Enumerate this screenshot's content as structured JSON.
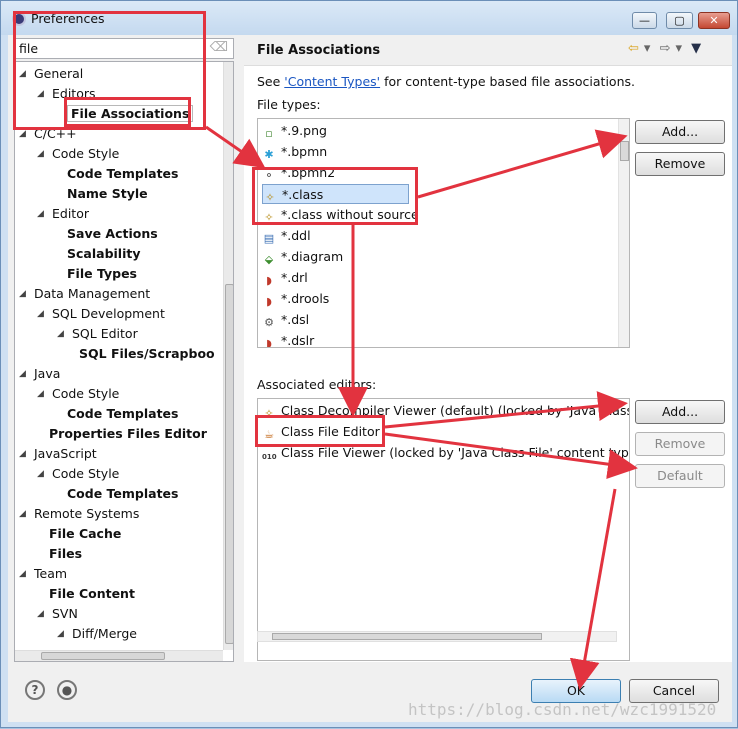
{
  "window": {
    "title": "Preferences",
    "min": "—",
    "max": "▢",
    "close": "✕"
  },
  "filter": {
    "value": "file"
  },
  "tree": [
    {
      "label": "General",
      "arrow": "◢",
      "bold": false
    },
    {
      "label": "Editors",
      "arrow": "◢",
      "bold": false
    },
    {
      "label": "File Associations",
      "arrow": "",
      "bold": true
    },
    {
      "label": "C/C++",
      "arrow": "◢",
      "bold": false
    },
    {
      "label": "Code Style",
      "arrow": "◢",
      "bold": false
    },
    {
      "label": "Code Templates",
      "arrow": "",
      "bold": true
    },
    {
      "label": "Name Style",
      "arrow": "",
      "bold": true
    },
    {
      "label": "Editor",
      "arrow": "◢",
      "bold": false
    },
    {
      "label": "Save Actions",
      "arrow": "",
      "bold": true
    },
    {
      "label": "Scalability",
      "arrow": "",
      "bold": true
    },
    {
      "label": "File Types",
      "arrow": "",
      "bold": true
    },
    {
      "label": "Data Management",
      "arrow": "◢",
      "bold": false
    },
    {
      "label": "SQL Development",
      "arrow": "◢",
      "bold": false
    },
    {
      "label": "SQL Editor",
      "arrow": "◢",
      "bold": false
    },
    {
      "label": "SQL Files/Scrapboo",
      "arrow": "",
      "bold": true
    },
    {
      "label": "Java",
      "arrow": "◢",
      "bold": false
    },
    {
      "label": "Code Style",
      "arrow": "◢",
      "bold": false
    },
    {
      "label": "Code Templates",
      "arrow": "",
      "bold": true
    },
    {
      "label": "Properties Files Editor",
      "arrow": "",
      "bold": true
    },
    {
      "label": "JavaScript",
      "arrow": "◢",
      "bold": false
    },
    {
      "label": "Code Style",
      "arrow": "◢",
      "bold": false
    },
    {
      "label": "Code Templates",
      "arrow": "",
      "bold": true
    },
    {
      "label": "Remote Systems",
      "arrow": "◢",
      "bold": false
    },
    {
      "label": "File Cache",
      "arrow": "",
      "bold": true
    },
    {
      "label": "Files",
      "arrow": "",
      "bold": true
    },
    {
      "label": "Team",
      "arrow": "◢",
      "bold": false
    },
    {
      "label": "File Content",
      "arrow": "",
      "bold": true
    },
    {
      "label": "SVN",
      "arrow": "◢",
      "bold": false
    },
    {
      "label": "Diff/Merge",
      "arrow": "◢",
      "bold": false
    }
  ],
  "page": {
    "title": "File Associations",
    "see_prefix": "See ",
    "see_link": "'Content Types'",
    "see_suffix": " for content-type based file associations.",
    "file_types_label": "File types:",
    "file_types": [
      {
        "label": "*.9.png",
        "icon": "image-file-icon",
        "glyph": "▫",
        "color": "#4c8d3c"
      },
      {
        "label": "*.bpmn",
        "icon": "bpmn-icon",
        "glyph": "✱",
        "color": "#2a9fd6"
      },
      {
        "label": "*.bpmn2",
        "icon": "bpmn2-icon",
        "glyph": "⚬",
        "color": "#444444"
      },
      {
        "label": "*.class",
        "icon": "class-file-icon",
        "glyph": "✧",
        "color": "#b78b16"
      },
      {
        "label": "*.class without source",
        "icon": "class-no-source-icon",
        "glyph": "✧",
        "color": "#b78b16"
      },
      {
        "label": "*.ddl",
        "icon": "ddl-file-icon",
        "glyph": "▤",
        "color": "#3b6fb4"
      },
      {
        "label": "*.diagram",
        "icon": "diagram-file-icon",
        "glyph": "⬙",
        "color": "#3d8e2f"
      },
      {
        "label": "*.drl",
        "icon": "drools-file-icon",
        "glyph": "◗",
        "color": "#c0392b"
      },
      {
        "label": "*.drools",
        "icon": "drools-file-icon",
        "glyph": "◗",
        "color": "#c0392b"
      },
      {
        "label": "*.dsl",
        "icon": "dsl-file-icon",
        "glyph": "⚙",
        "color": "#555555"
      },
      {
        "label": "*.dslr",
        "icon": "dslr-file-icon",
        "glyph": "◗",
        "color": "#c0392b"
      }
    ],
    "assoc_label": "Associated editors:",
    "editors": [
      {
        "label": "Class Decompiler Viewer (default) (locked by 'Java Class File'",
        "icon": "class-decompiler-icon",
        "glyph": "✧",
        "color": "#b78b16"
      },
      {
        "label": "Class File Editor",
        "icon": "class-file-editor-icon",
        "glyph": "☕",
        "color": "#c46a1b"
      },
      {
        "label": "Class File Viewer (locked by 'Java Class File' content type)",
        "icon": "class-file-viewer-icon",
        "glyph": "010",
        "color": "#3a3a3a"
      }
    ],
    "add_btn": "Add...",
    "remove_btn": "Remove",
    "add2_btn": "Add...",
    "remove2_btn": "Remove",
    "default_btn": "Default"
  },
  "bottom": {
    "help": "?",
    "ok": "OK",
    "cancel": "Cancel",
    "watermark": "https://blog.csdn.net/wzc1991520"
  },
  "annotation_color": "#e2333f"
}
